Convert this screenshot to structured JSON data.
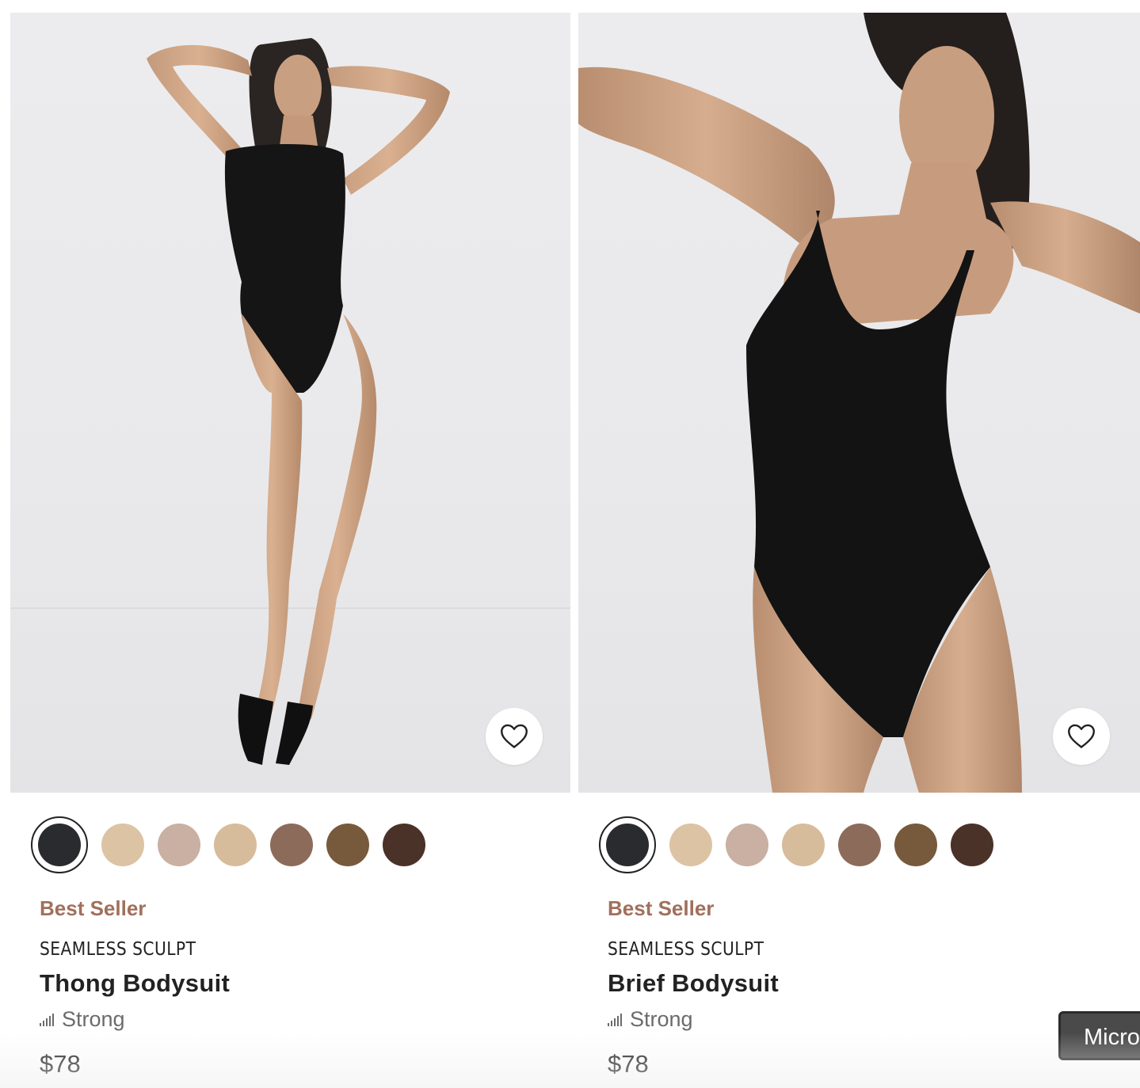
{
  "products": [
    {
      "badge": "Best Seller",
      "collection": "SEAMLESS SCULPT",
      "name": "Thong Bodysuit",
      "support_level": "Strong",
      "price": "$78",
      "wishlist_icon": "heart-outline-icon",
      "swatches": [
        "#2a2b2e",
        "#dcc3a3",
        "#c9b0a2",
        "#d7bc9b",
        "#8d6b5b",
        "#775a3c",
        "#4a3228"
      ],
      "selected_swatch_index": 0
    },
    {
      "badge": "Best Seller",
      "collection": "SEAMLESS SCULPT",
      "name": "Brief Bodysuit",
      "support_level": "Strong",
      "price": "$78",
      "wishlist_icon": "heart-outline-icon",
      "swatches": [
        "#2a2b2e",
        "#dcc3a3",
        "#c9b0a2",
        "#d7bc9b",
        "#8d6b5b",
        "#775a3c",
        "#4a3228"
      ],
      "selected_swatch_index": 0
    }
  ],
  "floating_chip": {
    "label": "Micro"
  },
  "colors": {
    "badge": "#a0705c",
    "text": "#222222",
    "muted": "#6b6b6b",
    "media_bg": "#ebebed"
  }
}
